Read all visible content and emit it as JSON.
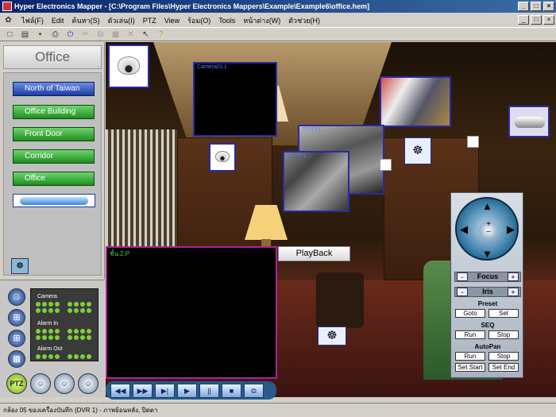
{
  "window": {
    "title": "Hyper Electronics Mapper - [C:\\Program Files\\Hyper Electronics Mappers\\Example\\Example6\\office.hem]",
    "min_label": "_",
    "max_label": "□",
    "close_label": "×"
  },
  "menu": {
    "items": [
      "ไฟล์(F)",
      "Edit",
      "ค้นหา(S)",
      "ตัวเล่น(I)",
      "PTZ",
      "View",
      "ร้อม(O)",
      "Tools",
      "หน้าต่าง(W)",
      "ตัวช่วย(H)"
    ]
  },
  "toolbar": {
    "icons": [
      "new",
      "open",
      "save",
      "print",
      "power",
      "cut",
      "copy",
      "paste",
      "delete",
      "pointer",
      "help"
    ],
    "glyphs": [
      "□",
      "▤",
      "▪",
      "⎙",
      "⏻",
      "✂",
      "⧉",
      "▦",
      "✕",
      "↖",
      "?"
    ]
  },
  "left_panel": {
    "title": "Office",
    "nav": [
      "North of Taiwan",
      "Office Building",
      "Front Door",
      "Corridor",
      "Office"
    ],
    "selected_index": 0
  },
  "camera_panel": {
    "labels": {
      "camera": "Camera",
      "alarm_in": "Alarm In",
      "alarm_out": "Alarm Out"
    },
    "layout_buttons": [
      "□",
      "⊞",
      "⊞",
      "▦"
    ],
    "bottom_buttons": [
      "PTZ",
      "☺",
      "☺",
      "☺"
    ]
  },
  "scene": {
    "camera01_label": "Camera01.L",
    "cam_a_label": "?????.L",
    "cam_b_label": "?????.L"
  },
  "playback": {
    "view_label": "ชั้น.2.P",
    "label": "PlayBack",
    "transport": [
      "◀◀",
      "▶▶",
      "▶|",
      "▶",
      "||",
      "■",
      "⧉"
    ]
  },
  "ptz": {
    "focus_label": "Focus",
    "iris_label": "Iris",
    "minus": "-",
    "plus": "+",
    "zoom_plus": "+",
    "zoom_minus": "−",
    "preset_title": "Preset",
    "goto_label": "Goto",
    "set_label": "Set",
    "seq_title": "SEQ",
    "run_label": "Run",
    "stop_label": "Stop",
    "autopan_title": "AutoPan",
    "set_start_label": "Set Start",
    "set_end_label": "Set End"
  },
  "status": {
    "text": "กล้อง 05 ของเครื่องบันทึก (DVR 1) - ภาพย้อนหลัง, ปิดตา"
  }
}
